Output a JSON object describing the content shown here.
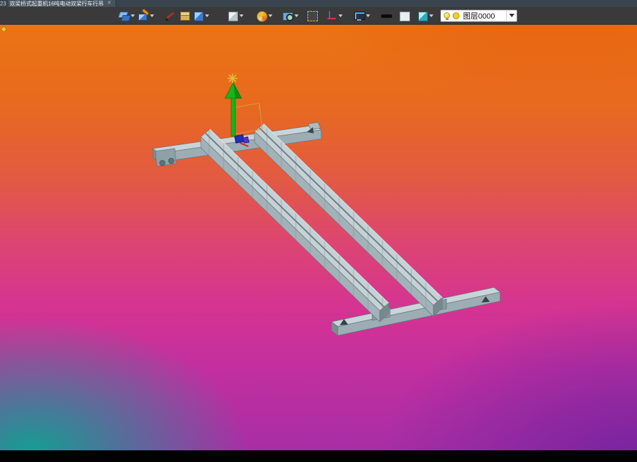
{
  "window": {
    "tab_prefix": "23",
    "tab_title": "双梁桥式起重机16吨电动双梁行车行吊",
    "close_glyph": "✕"
  },
  "toolbar": {
    "layer_combo": {
      "value": "图层0000"
    },
    "icons": [
      {
        "name": "orbit-icon"
      },
      {
        "name": "paint-style-icon"
      },
      {
        "name": "pen-icon"
      },
      {
        "name": "package-icon"
      },
      {
        "name": "cube-blue-icon"
      },
      {
        "name": "cube-light-icon"
      },
      {
        "name": "color-wheel-icon"
      },
      {
        "name": "zoom-image-icon"
      },
      {
        "name": "marquee-icon"
      },
      {
        "name": "axes-icon"
      },
      {
        "name": "display-icon"
      },
      {
        "name": "line-swatch-black-icon"
      },
      {
        "name": "fill-swatch-light-icon"
      },
      {
        "name": "material-cube-icon"
      },
      {
        "name": "bulb-icon"
      },
      {
        "name": "layer-color-icon"
      }
    ]
  },
  "viewport": {
    "colors": {
      "axis_arrow_green": "#17b517",
      "selection_wire_orange": "#d79d2e",
      "model_gray": "#b9c6cb",
      "gradient_top": "#ec7414",
      "gradient_mid": "#dc4474",
      "gradient_bottom_left": "#0da392",
      "gradient_bottom_right": "#7022 9e"
    }
  }
}
